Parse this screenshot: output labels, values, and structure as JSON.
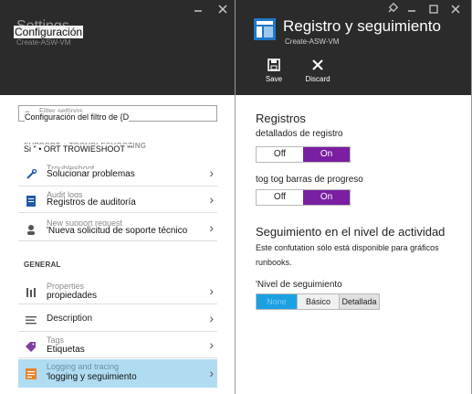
{
  "left_blade": {
    "ghost_title": "Settings",
    "ghost_subtitle": "Create-ASW-VM",
    "title": "Configuración",
    "filter": {
      "placeholder": "Filter settings",
      "label": "Configuración del filtro de {D"
    },
    "support_section": {
      "ghost_heading": "SUPPORT + TROUBLESHOOTING",
      "heading": "Si \" • ORT TROWIESHOOT \"\""
    },
    "support_items": [
      {
        "ghost": "Troubleshoot",
        "label": "Solucionar problemas",
        "icon": "wrench-icon"
      },
      {
        "ghost": "Audit logs",
        "label": "Registros de auditoría",
        "icon": "audit-log-icon"
      },
      {
        "ghost": "New support request",
        "label": "'Nueva solicitud de soporte técnico",
        "icon": "support-person-icon"
      }
    ],
    "general_heading": "GENERAL",
    "general_items": [
      {
        "ghost": "Properties",
        "label": "propiedades",
        "icon": "properties-bars-icon"
      },
      {
        "ghost": "",
        "label": "Description",
        "icon": "description-lines-icon"
      },
      {
        "ghost": "Tags",
        "label": "Etiquetas",
        "icon": "tag-icon"
      },
      {
        "ghost": "Logging and tracing",
        "label": "'logging y seguimiento",
        "icon": "logging-icon",
        "selected": true
      }
    ]
  },
  "right_blade": {
    "title": "Registro y seguimiento",
    "subtitle": "Create-ASW-VM",
    "commands": {
      "save": "Save",
      "discard": "Discard"
    },
    "verbose_logging": {
      "title": "Registros",
      "label": "detallados de registro",
      "off": "Off",
      "on": "On",
      "value": "On"
    },
    "progress_bars": {
      "label": "tog tog barras de progreso",
      "off": "Off",
      "on": "On",
      "value": "On"
    },
    "activity_tracing": {
      "title": "Seguimiento en el nivel de actividad",
      "note_line1": "Este confutation sólo está disponible para gráficos",
      "note_line2": "runbooks.",
      "level_label": "'Nivel de seguimiento",
      "options": [
        "None",
        "Básico",
        "Detallada"
      ],
      "selected": "None"
    }
  },
  "colors": {
    "header_bg": "#2b2b2b",
    "toggle_on": "#7a1fa2",
    "level_selected": "#1ba1e2",
    "selected_row": "#b0dcf2"
  }
}
